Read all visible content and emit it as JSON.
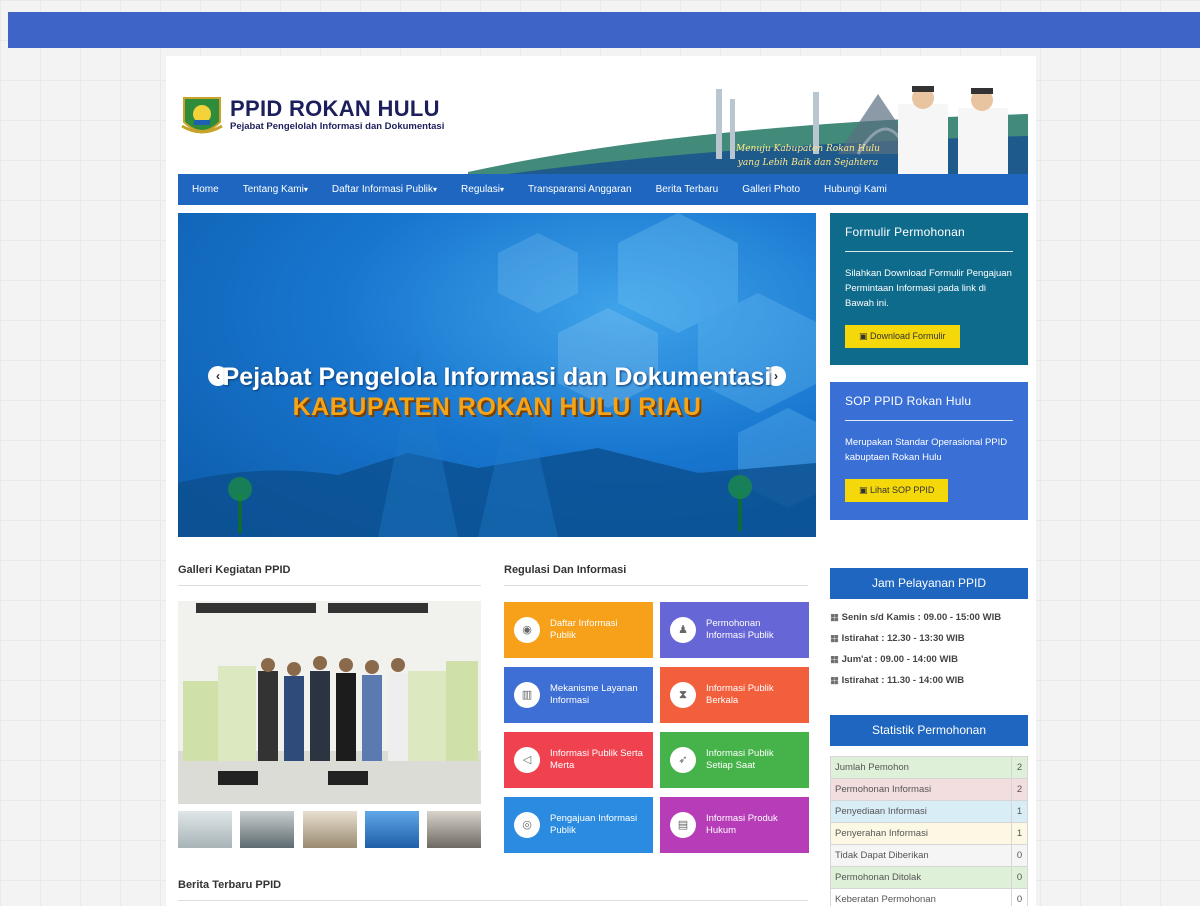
{
  "site": {
    "title": "PPID ROKAN HULU",
    "subtitle": "Pejabat Pengelolah Informasi dan Dokumentasi",
    "motto_line1": "Menuju Kabupaten Rokan Hulu",
    "motto_line2": "yang Lebih Baik dan Sejahtera"
  },
  "nav": [
    {
      "label": "Home",
      "caret": ""
    },
    {
      "label": "Tentang Kami",
      "caret": "▾"
    },
    {
      "label": "Daftar Informasi Publik",
      "caret": "▾"
    },
    {
      "label": "Regulasi",
      "caret": "▾"
    },
    {
      "label": "Transparansi Anggaran",
      "caret": ""
    },
    {
      "label": "Berita Terbaru",
      "caret": ""
    },
    {
      "label": "Galleri Photo",
      "caret": ""
    },
    {
      "label": "Hubungi Kami",
      "caret": ""
    }
  ],
  "slider": {
    "title": "Pejabat Pengelola Informasi dan Dokumentasi",
    "subtitle": "KABUPATEN ROKAN HULU RIAU",
    "prev": "‹",
    "next": "›"
  },
  "formulir": {
    "title": "Formulir Permohonan",
    "text": "Silahkan Download Formulir Pengajuan Permintaan Informasi pada link di Bawah ini.",
    "button": "Download Formulir",
    "color": "#0f6b8c"
  },
  "sop": {
    "title": "SOP PPID Rokan Hulu",
    "text": "Merupakan Standar Operasional PPID kabuptaen Rokan Hulu",
    "button": "Lihat SOP PPID",
    "color": "#3a6fd6"
  },
  "jam": {
    "title": "Jam Pelayanan PPID",
    "items": [
      "Senin s/d Kamis : 09.00 - 15:00 WIB",
      "Istirahat : 12.30 - 13:30 WIB",
      "Jum'at : 09.00 - 14:00 WIB",
      "Istirahat : 11.30 - 14:00 WIB"
    ]
  },
  "statistik": {
    "title": "Statistik Permohonan",
    "rows": [
      {
        "label": "Jumlah Pemohon",
        "value": "2",
        "color": "#dff0d8"
      },
      {
        "label": "Permohonan Informasi",
        "value": "2",
        "color": "#f2dede"
      },
      {
        "label": "Penyediaan Informasi",
        "value": "1",
        "color": "#d9edf7"
      },
      {
        "label": "Penyerahan Informasi",
        "value": "1",
        "color": "#fcf8e3"
      },
      {
        "label": "Tidak Dapat Diberikan",
        "value": "0",
        "color": "#f5f5f5"
      },
      {
        "label": "Permohonan Ditolak",
        "value": "0",
        "color": "#dff0d8"
      },
      {
        "label": "Keberatan Permohonan",
        "value": "0",
        "color": "#ffffff"
      }
    ]
  },
  "galleri": {
    "title": "Galleri Kegiatan PPID"
  },
  "regulasi": {
    "title": "Regulasi Dan Informasi",
    "tiles": [
      {
        "label": "Daftar Informasi Publik",
        "color": "#f7a11a",
        "icon": "eye-icon"
      },
      {
        "label": "Permohonan Informasi Publik",
        "color": "#6666d6",
        "icon": "user-icon"
      },
      {
        "label": "Mekanisme Layanan Informasi",
        "color": "#3e6fd4",
        "icon": "books-icon"
      },
      {
        "label": "Informasi Publik Berkala",
        "color": "#f25f3c",
        "icon": "hourglass-icon"
      },
      {
        "label": "Informasi Publik Serta Merta",
        "color": "#f0424e",
        "icon": "megaphone-icon"
      },
      {
        "label": "Informasi Publik Setiap Saat",
        "color": "#46b34a",
        "icon": "rocket-icon"
      },
      {
        "label": "Pengajuan Informasi Publik",
        "color": "#2b8be0",
        "icon": "ring-icon"
      },
      {
        "label": "Informasi Produk Hukum",
        "color": "#b63cb8",
        "icon": "document-icon"
      }
    ]
  },
  "berita": {
    "title": "Berita Terbaru PPID"
  }
}
